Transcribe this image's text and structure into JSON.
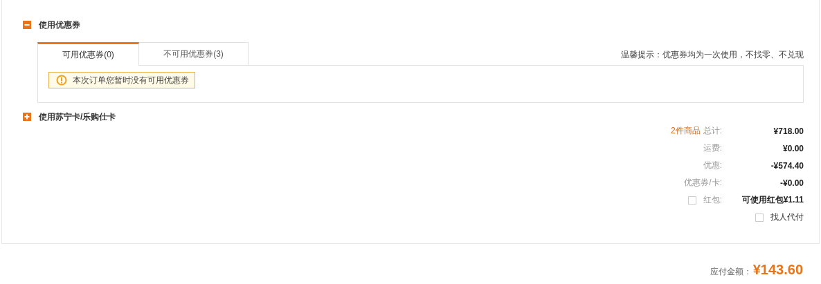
{
  "coupon_section": {
    "title": "使用优惠券",
    "expanded": true,
    "tabs": [
      {
        "label": "可用优惠券(0)",
        "selected": true
      },
      {
        "label": "不可用优惠券(3)",
        "selected": false
      }
    ],
    "tip": "温馨提示：优惠券均为一次使用，不找零、不兑现",
    "notice": "本次订单您暂时没有可用优惠券"
  },
  "card_section": {
    "title": "使用苏宁卡/乐购仕卡",
    "expanded": false
  },
  "summary": [
    {
      "kind": "count",
      "count": "2件商品",
      "label": "总计:",
      "value": "¥718.00"
    },
    {
      "kind": "plain",
      "label": "运费:",
      "value": "¥0.00"
    },
    {
      "kind": "plain",
      "label": "优惠:",
      "value": "-¥574.40"
    },
    {
      "kind": "plain",
      "label": "优惠券/卡:",
      "value": "-¥0.00"
    },
    {
      "kind": "check",
      "checked": false,
      "label": "红包:",
      "value": "可使用红包¥1.11"
    }
  ],
  "pay_for_me": {
    "label": "找人代付",
    "checked": false
  },
  "total": {
    "label": "应付金额：",
    "value": "¥143.60"
  }
}
